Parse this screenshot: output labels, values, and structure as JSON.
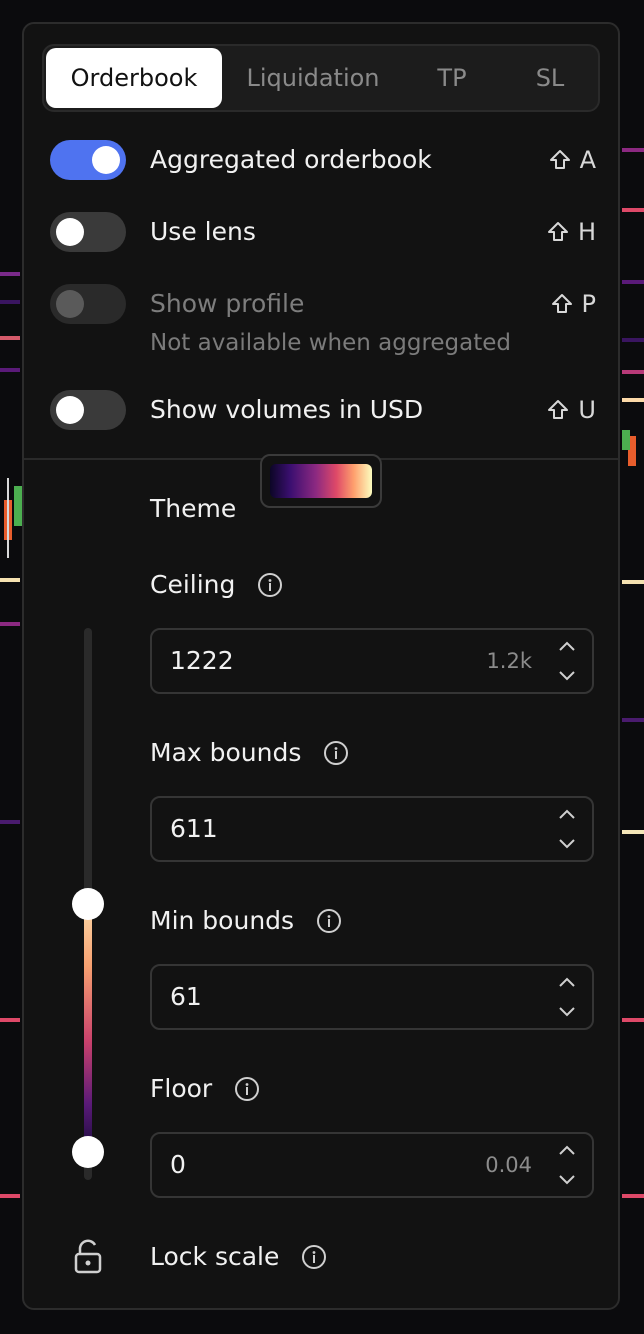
{
  "tabs": [
    {
      "label": "Orderbook",
      "active": true
    },
    {
      "label": "Liquidation",
      "active": false
    },
    {
      "label": "TP",
      "active": false
    },
    {
      "label": "SL",
      "active": false
    }
  ],
  "toggles": [
    {
      "label": "Aggregated orderbook",
      "on": true,
      "shortcut": "A"
    },
    {
      "label": "Use lens",
      "on": false,
      "shortcut": "H"
    },
    {
      "label": "Show profile",
      "on": false,
      "disabled": true,
      "subtext": "Not available when aggregated",
      "shortcut": "P"
    },
    {
      "label": "Show volumes in USD",
      "on": false,
      "shortcut": "U"
    }
  ],
  "theme": {
    "label": "Theme"
  },
  "ceiling": {
    "label": "Ceiling",
    "value": "1222",
    "hint": "1.2k"
  },
  "max_bounds": {
    "label": "Max bounds",
    "value": "611"
  },
  "min_bounds": {
    "label": "Min bounds",
    "value": "61"
  },
  "floor": {
    "label": "Floor",
    "value": "0",
    "hint": "0.04"
  },
  "lock_scale": {
    "label": "Lock scale"
  },
  "icons": [
    "shift-icon",
    "info-icon",
    "chevron-up-icon",
    "chevron-down-icon",
    "lock-open-icon"
  ],
  "colors": {
    "accent": "#4f73f0",
    "panel": "#121212"
  }
}
